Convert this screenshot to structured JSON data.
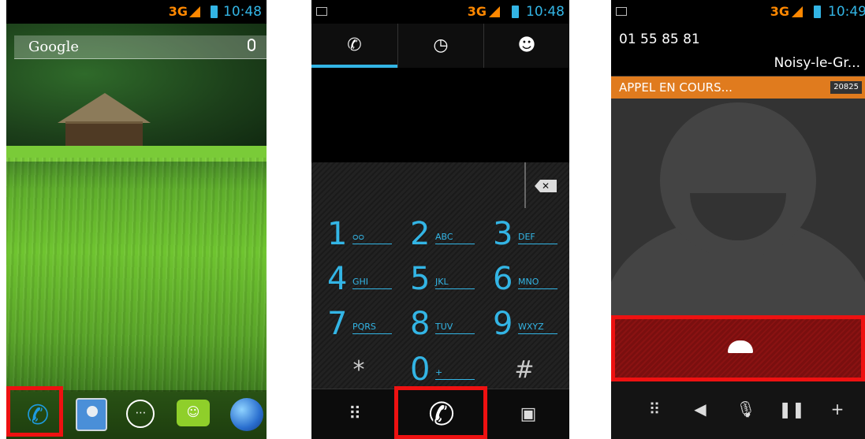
{
  "colors": {
    "accent": "#33b5e5",
    "network": "#ff8800",
    "highlight": "#ee1111",
    "in_call": "#e07b1e",
    "end_call": "#8a1212"
  },
  "phone1": {
    "status": {
      "network": "3G",
      "time": "10:48"
    },
    "search": {
      "label": "Google"
    },
    "dock": {
      "phone": "phone-icon",
      "contacts": "contacts-icon",
      "apps": "⋯",
      "messages": "☺",
      "browser": "globe-icon"
    }
  },
  "phone2": {
    "status": {
      "network": "3G",
      "time": "10:48"
    },
    "tabs": [
      "phone-icon",
      "clock-icon",
      "person-icon"
    ],
    "backspace": "✕",
    "keys": [
      {
        "num": "1",
        "letters": "ᴑᴑ"
      },
      {
        "num": "2",
        "letters": "ABC"
      },
      {
        "num": "3",
        "letters": "DEF"
      },
      {
        "num": "4",
        "letters": "GHI"
      },
      {
        "num": "5",
        "letters": "JKL"
      },
      {
        "num": "6",
        "letters": "MNO"
      },
      {
        "num": "7",
        "letters": "PQRS"
      },
      {
        "num": "8",
        "letters": "TUV"
      },
      {
        "num": "9",
        "letters": "WXYZ"
      },
      {
        "num": "*",
        "letters": ""
      },
      {
        "num": "0",
        "letters": "+"
      },
      {
        "num": "#",
        "letters": ""
      }
    ],
    "bottom": {
      "dialpad": "⠿",
      "call": "✆",
      "contacts": "▣"
    }
  },
  "phone3": {
    "status": {
      "network": "3G",
      "time": "10:49"
    },
    "caller_number": "01 55 85 81",
    "caller_location": "Noisy-le-Gr...",
    "call_state": "APPEL EN COURS...",
    "call_timer": "20825",
    "actions": {
      "dialpad": "⠿",
      "speaker": "◀",
      "mute": "🎙",
      "hold": "❚❚",
      "add_call": "+"
    }
  }
}
